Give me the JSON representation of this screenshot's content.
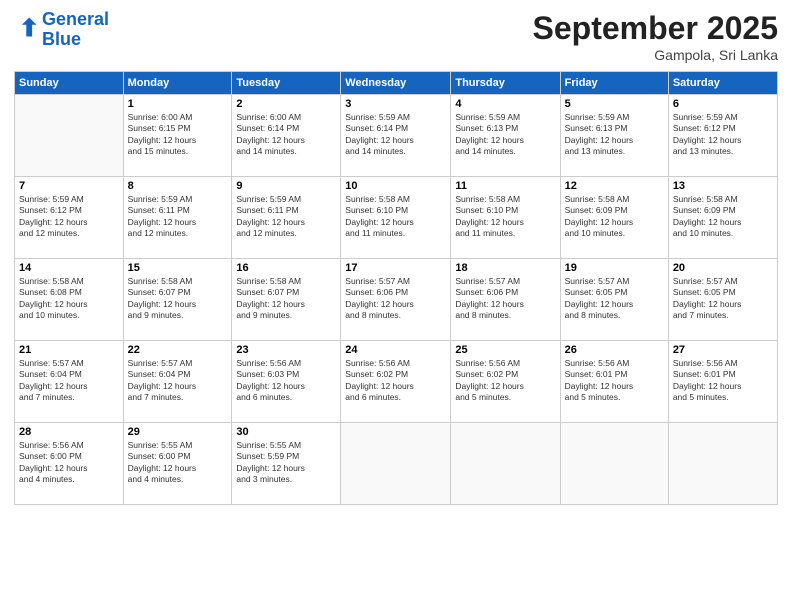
{
  "logo": {
    "line1": "General",
    "line2": "Blue"
  },
  "title": "September 2025",
  "subtitle": "Gampola, Sri Lanka",
  "days_of_week": [
    "Sunday",
    "Monday",
    "Tuesday",
    "Wednesday",
    "Thursday",
    "Friday",
    "Saturday"
  ],
  "weeks": [
    [
      {
        "day": "",
        "info": ""
      },
      {
        "day": "1",
        "info": "Sunrise: 6:00 AM\nSunset: 6:15 PM\nDaylight: 12 hours\nand 15 minutes."
      },
      {
        "day": "2",
        "info": "Sunrise: 6:00 AM\nSunset: 6:14 PM\nDaylight: 12 hours\nand 14 minutes."
      },
      {
        "day": "3",
        "info": "Sunrise: 5:59 AM\nSunset: 6:14 PM\nDaylight: 12 hours\nand 14 minutes."
      },
      {
        "day": "4",
        "info": "Sunrise: 5:59 AM\nSunset: 6:13 PM\nDaylight: 12 hours\nand 14 minutes."
      },
      {
        "day": "5",
        "info": "Sunrise: 5:59 AM\nSunset: 6:13 PM\nDaylight: 12 hours\nand 13 minutes."
      },
      {
        "day": "6",
        "info": "Sunrise: 5:59 AM\nSunset: 6:12 PM\nDaylight: 12 hours\nand 13 minutes."
      }
    ],
    [
      {
        "day": "7",
        "info": "Sunrise: 5:59 AM\nSunset: 6:12 PM\nDaylight: 12 hours\nand 12 minutes."
      },
      {
        "day": "8",
        "info": "Sunrise: 5:59 AM\nSunset: 6:11 PM\nDaylight: 12 hours\nand 12 minutes."
      },
      {
        "day": "9",
        "info": "Sunrise: 5:59 AM\nSunset: 6:11 PM\nDaylight: 12 hours\nand 12 minutes."
      },
      {
        "day": "10",
        "info": "Sunrise: 5:58 AM\nSunset: 6:10 PM\nDaylight: 12 hours\nand 11 minutes."
      },
      {
        "day": "11",
        "info": "Sunrise: 5:58 AM\nSunset: 6:10 PM\nDaylight: 12 hours\nand 11 minutes."
      },
      {
        "day": "12",
        "info": "Sunrise: 5:58 AM\nSunset: 6:09 PM\nDaylight: 12 hours\nand 10 minutes."
      },
      {
        "day": "13",
        "info": "Sunrise: 5:58 AM\nSunset: 6:09 PM\nDaylight: 12 hours\nand 10 minutes."
      }
    ],
    [
      {
        "day": "14",
        "info": "Sunrise: 5:58 AM\nSunset: 6:08 PM\nDaylight: 12 hours\nand 10 minutes."
      },
      {
        "day": "15",
        "info": "Sunrise: 5:58 AM\nSunset: 6:07 PM\nDaylight: 12 hours\nand 9 minutes."
      },
      {
        "day": "16",
        "info": "Sunrise: 5:58 AM\nSunset: 6:07 PM\nDaylight: 12 hours\nand 9 minutes."
      },
      {
        "day": "17",
        "info": "Sunrise: 5:57 AM\nSunset: 6:06 PM\nDaylight: 12 hours\nand 8 minutes."
      },
      {
        "day": "18",
        "info": "Sunrise: 5:57 AM\nSunset: 6:06 PM\nDaylight: 12 hours\nand 8 minutes."
      },
      {
        "day": "19",
        "info": "Sunrise: 5:57 AM\nSunset: 6:05 PM\nDaylight: 12 hours\nand 8 minutes."
      },
      {
        "day": "20",
        "info": "Sunrise: 5:57 AM\nSunset: 6:05 PM\nDaylight: 12 hours\nand 7 minutes."
      }
    ],
    [
      {
        "day": "21",
        "info": "Sunrise: 5:57 AM\nSunset: 6:04 PM\nDaylight: 12 hours\nand 7 minutes."
      },
      {
        "day": "22",
        "info": "Sunrise: 5:57 AM\nSunset: 6:04 PM\nDaylight: 12 hours\nand 7 minutes."
      },
      {
        "day": "23",
        "info": "Sunrise: 5:56 AM\nSunset: 6:03 PM\nDaylight: 12 hours\nand 6 minutes."
      },
      {
        "day": "24",
        "info": "Sunrise: 5:56 AM\nSunset: 6:02 PM\nDaylight: 12 hours\nand 6 minutes."
      },
      {
        "day": "25",
        "info": "Sunrise: 5:56 AM\nSunset: 6:02 PM\nDaylight: 12 hours\nand 5 minutes."
      },
      {
        "day": "26",
        "info": "Sunrise: 5:56 AM\nSunset: 6:01 PM\nDaylight: 12 hours\nand 5 minutes."
      },
      {
        "day": "27",
        "info": "Sunrise: 5:56 AM\nSunset: 6:01 PM\nDaylight: 12 hours\nand 5 minutes."
      }
    ],
    [
      {
        "day": "28",
        "info": "Sunrise: 5:56 AM\nSunset: 6:00 PM\nDaylight: 12 hours\nand 4 minutes."
      },
      {
        "day": "29",
        "info": "Sunrise: 5:55 AM\nSunset: 6:00 PM\nDaylight: 12 hours\nand 4 minutes."
      },
      {
        "day": "30",
        "info": "Sunrise: 5:55 AM\nSunset: 5:59 PM\nDaylight: 12 hours\nand 3 minutes."
      },
      {
        "day": "",
        "info": ""
      },
      {
        "day": "",
        "info": ""
      },
      {
        "day": "",
        "info": ""
      },
      {
        "day": "",
        "info": ""
      }
    ]
  ]
}
